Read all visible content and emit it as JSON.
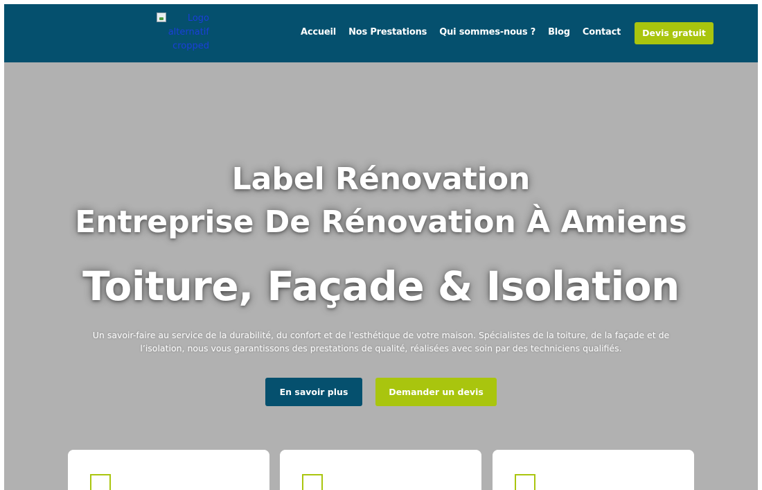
{
  "header": {
    "logo_alt": "Logo alternatif cropped",
    "nav": [
      {
        "label": "Accueil"
      },
      {
        "label": "Nos Prestations"
      },
      {
        "label": "Qui sommes-nous ?"
      },
      {
        "label": "Blog"
      },
      {
        "label": "Contact"
      }
    ],
    "cta_label": "Devis gratuit"
  },
  "hero": {
    "title_line1": "Label Rénovation",
    "title_line2": "Entreprise De Rénovation À Amiens",
    "headline": "Toiture, Façade & Isolation",
    "description": "Un savoir-faire au service de la durabilité, du confort et de l’esthétique de votre maison. Spécialistes de la toiture, de la façade et de l’isolation, nous vous garantissons des prestations de qualité, réalisées avec soin par des techniciens qualifiés.",
    "primary_button": "En savoir plus",
    "secondary_button": "Demander un devis"
  },
  "cards": [
    {
      "icon": "service-icon"
    },
    {
      "icon": "service-icon"
    },
    {
      "icon": "service-icon"
    }
  ],
  "colors": {
    "brand_blue": "#05506e",
    "accent_green": "#a9c50e",
    "hero_background": "#b1b1b1"
  }
}
